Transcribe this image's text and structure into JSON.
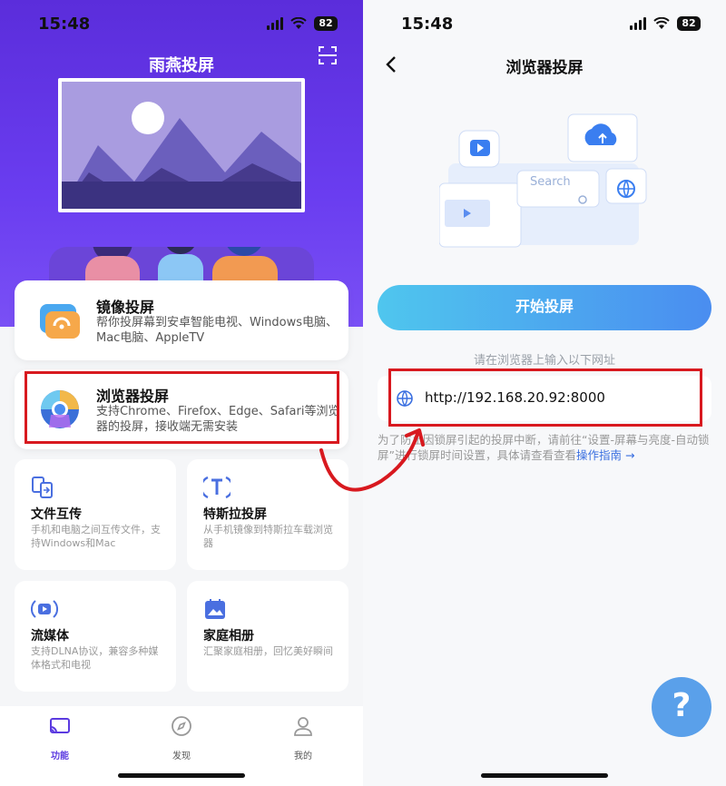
{
  "left": {
    "status": {
      "time": "15:48",
      "battery": "82"
    },
    "app_title": "雨燕投屏",
    "features": [
      {
        "title": "镜像投屏",
        "desc": "帮你投屏幕到安卓智能电视、Windows电脑、Mac电脑、AppleTV"
      },
      {
        "title": "浏览器投屏",
        "desc": "支持Chrome、Firefox、Edge、Safari等浏览器的投屏，接收端无需安装"
      }
    ],
    "tiles": [
      {
        "title": "文件互传",
        "desc": "手机和电脑之间互传文件，支持Windows和Mac"
      },
      {
        "title": "特斯拉投屏",
        "desc": "从手机镜像到特斯拉车载浏览器"
      },
      {
        "title": "流媒体",
        "desc": "支持DLNA协议，兼容多种媒体格式和电视"
      },
      {
        "title": "家庭相册",
        "desc": "汇聚家庭相册，回忆美好瞬间"
      }
    ],
    "tabs": [
      {
        "label": "功能"
      },
      {
        "label": "发现"
      },
      {
        "label": "我的"
      }
    ]
  },
  "right": {
    "status": {
      "time": "15:48",
      "battery": "82"
    },
    "page_title": "浏览器投屏",
    "illustration": {
      "search_label": "Search"
    },
    "start_button": "开始投屏",
    "hint": "请在浏览器上输入以下网址",
    "url": "http://192.168.20.92:8000",
    "note": "为了防止因锁屏引起的投屏中断，请前往“设置-屏幕与亮度-自动锁屏”进行锁屏时间设置，具体请查看查看",
    "note_link": "操作指南 →",
    "help": "?"
  },
  "colors": {
    "accent": "#5b3ae0",
    "highlight": "#d8191f",
    "button": "#4a8df0"
  }
}
